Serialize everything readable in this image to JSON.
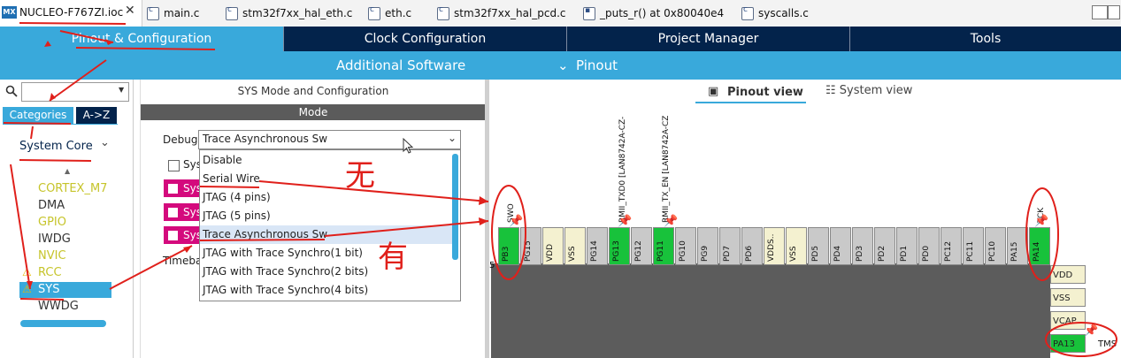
{
  "file_tabs": {
    "active": "NUCLEO-F767ZI.ioc",
    "active_badge": "MX",
    "others": [
      "main.c",
      "stm32f7xx_hal_eth.c",
      "eth.c",
      "stm32f7xx_hal_pcd.c",
      "_puts_r() at 0x80040e4",
      "syscalls.c"
    ]
  },
  "nav": {
    "tabs": [
      "Pinout & Configuration",
      "Clock Configuration",
      "Project Manager",
      "Tools"
    ],
    "additional_software": "Additional Software",
    "pinout_menu": "Pinout"
  },
  "left": {
    "categories_tab": "Categories",
    "az_tab": "A->Z",
    "group": "System Core",
    "items": [
      "CORTEX_M7",
      "DMA",
      "GPIO",
      "IWDG",
      "NVIC",
      "RCC",
      "SYS",
      "WWDG"
    ]
  },
  "mid": {
    "title": "SYS Mode and Configuration",
    "mode_header": "Mode",
    "debug_label": "Debug",
    "debug_value": "Trace Asynchronous Sw",
    "checkbox_label": "Sys",
    "magenta_labels": [
      "Sys",
      "Sys",
      "Sys"
    ],
    "timebase_label": "Timeba",
    "dropdown_options": [
      "Disable",
      "Serial Wire",
      "JTAG (4 pins)",
      "JTAG (5 pins)",
      "Trace Asynchronous Sw",
      "JTAG with Trace Synchro(1 bit)",
      "JTAG with Trace Synchro(2 bits)",
      "JTAG with Trace Synchro(4 bits)"
    ]
  },
  "pinout": {
    "pinout_view": "Pinout view",
    "system_view": "System view",
    "pins": [
      "PB3",
      "PG15",
      "VDD",
      "VSS",
      "PG14",
      "PG13",
      "PG12",
      "PG11",
      "PG10",
      "PG9",
      "PD7",
      "PD6",
      "VDDS..",
      "VSS",
      "PD5",
      "PD4",
      "PD3",
      "PD2",
      "PD1",
      "PD0",
      "PC12",
      "PC11",
      "PC10",
      "PA15",
      "PA14"
    ],
    "above_labels": {
      "swo": "SWO",
      "rmii_txd0": "RMII_TXD0 [LAN8742A-CZ-",
      "rmii_tx_en": "RMII_TX_EN [LAN8742A-CZ",
      "tck": "TCK"
    },
    "right_pins": [
      "VDD",
      "VSS",
      "VCAP..",
      "PA13"
    ],
    "tms_label": "TMS",
    "pin_fragment": "5"
  },
  "annotations": {
    "no": "无",
    "yes": "有"
  },
  "colors": {
    "accent": "#39a9db",
    "nav_dark": "#03234b",
    "pin_green": "#18c23b",
    "magenta": "#d40a7d",
    "annotation_red": "#e0201b"
  }
}
